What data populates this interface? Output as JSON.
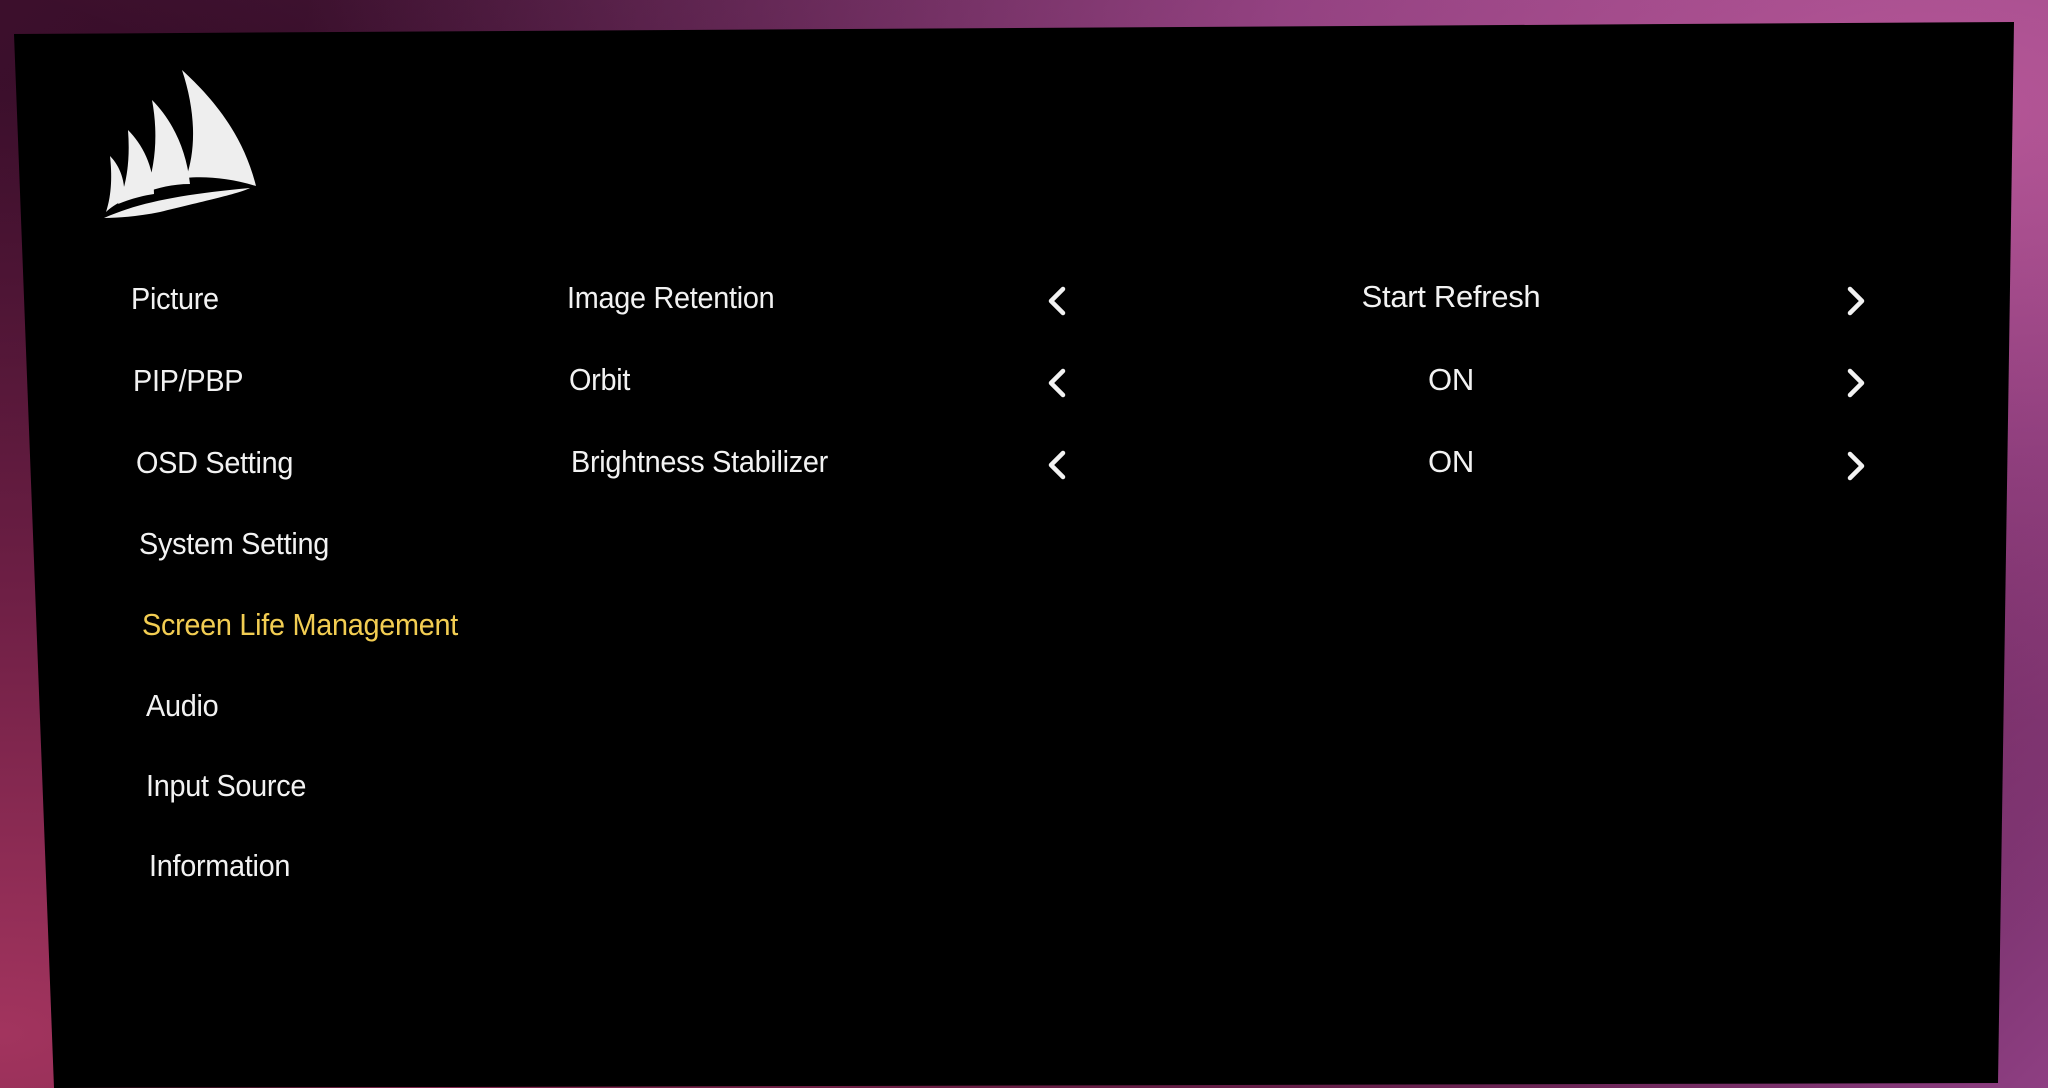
{
  "sidebar": {
    "logo_icon": "corsair-sails-logo",
    "active_color": "#f2cd52",
    "items": [
      {
        "label": "Picture"
      },
      {
        "label": "PIP/PBP"
      },
      {
        "label": "OSD Setting"
      },
      {
        "label": "System Setting"
      },
      {
        "label": "Screen Life Management",
        "active": true
      },
      {
        "label": "Audio"
      },
      {
        "label": "Input Source"
      },
      {
        "label": "Information"
      }
    ]
  },
  "options": [
    {
      "label": "Image Retention",
      "value": "Start Refresh",
      "prev_icon": "chevron-left-icon",
      "next_icon": "chevron-right-icon"
    },
    {
      "label": "Orbit",
      "value": "ON",
      "prev_icon": "chevron-left-icon",
      "next_icon": "chevron-right-icon"
    },
    {
      "label": "Brightness Stabilizer",
      "value": "ON",
      "prev_icon": "chevron-left-icon",
      "next_icon": "chevron-right-icon"
    }
  ]
}
